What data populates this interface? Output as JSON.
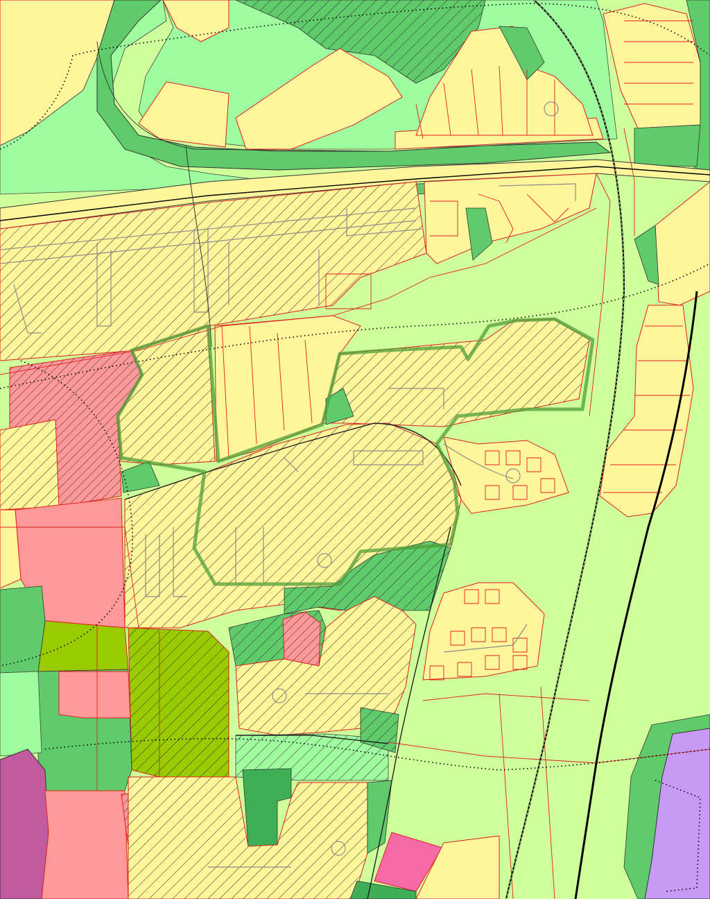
{
  "map": {
    "colors": {
      "background": "#cfff9a",
      "residential": "#fff59a",
      "green_light": "#9ffc9f",
      "green_mid": "#5fcb6a",
      "green_dark": "#3fae55",
      "agri": "#99cc00",
      "pink": "#ff9999",
      "pink_hot": "#f76aa8",
      "purple": "#c79af5",
      "magenta": "#c15a9f",
      "parcel_line": "#e11f1f",
      "road_line": "#8c8c8c",
      "boundary": "#000000",
      "plan_outline": "#4f9f3a"
    },
    "layers": [
      "residential-zone",
      "green-zone",
      "agricultural-zone",
      "commercial-zone",
      "public-zone",
      "hatched-planned-zone",
      "parcel-boundaries",
      "roads",
      "railway",
      "municipal-boundary",
      "plan-area-outline"
    ]
  }
}
